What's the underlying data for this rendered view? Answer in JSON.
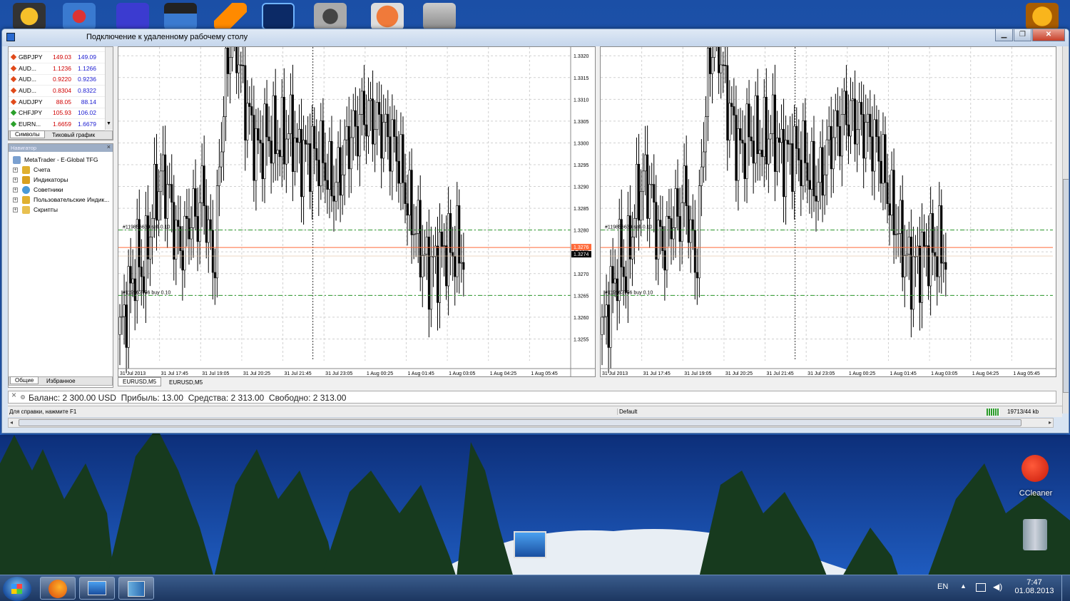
{
  "window": {
    "title": "Подключение к удаленному рабочему столу",
    "buttons": [
      "minimize",
      "maximize",
      "close"
    ]
  },
  "market_watch": {
    "rows": [
      {
        "symbol": "GBPJPY",
        "bid": "149.03",
        "ask": "149.09",
        "trend": "down"
      },
      {
        "symbol": "AUD...",
        "bid": "1.1236",
        "ask": "1.1266",
        "trend": "down"
      },
      {
        "symbol": "AUD...",
        "bid": "0.9220",
        "ask": "0.9236",
        "trend": "down"
      },
      {
        "symbol": "AUD...",
        "bid": "0.8304",
        "ask": "0.8322",
        "trend": "down"
      },
      {
        "symbol": "AUDJPY",
        "bid": "88.05",
        "ask": "88.14",
        "trend": "down"
      },
      {
        "symbol": "CHFJPY",
        "bid": "105.93",
        "ask": "106.02",
        "trend": "up"
      },
      {
        "symbol": "EURN...",
        "bid": "1.6659",
        "ask": "1.6679",
        "trend": "up"
      }
    ],
    "tabs": [
      "Символы",
      "Тиковый график"
    ]
  },
  "navigator": {
    "title": "Навигатор",
    "items": [
      {
        "label": "MetaTrader - E-Global TFG",
        "icon": "terminal-icon"
      },
      {
        "label": "Счета",
        "icon": "accounts-icon"
      },
      {
        "label": "Индикаторы",
        "icon": "indicators-icon"
      },
      {
        "label": "Советники",
        "icon": "experts-icon"
      },
      {
        "label": "Пользовательские Индик...",
        "icon": "custom-indicators-icon"
      },
      {
        "label": "Скрипты",
        "icon": "scripts-icon"
      }
    ],
    "tabs": [
      "Общие",
      "Избранное"
    ]
  },
  "chart_data": [
    {
      "type": "candlestick",
      "symbol": "EURUSD,M5",
      "ylim": [
        1.325,
        1.3322
      ],
      "y_ticks": [
        "1.3320",
        "1.3315",
        "1.3310",
        "1.3305",
        "1.3300",
        "1.3295",
        "1.3290",
        "1.3285",
        "1.3280",
        "1.3275",
        "1.3270",
        "1.3265",
        "1.3260",
        "1.3255"
      ],
      "x_ticks": [
        "31 Jul 2013",
        "31 Jul 17:45",
        "31 Jul 19:05",
        "31 Jul 20:25",
        "31 Jul 21:45",
        "31 Jul 23:05",
        "1 Aug 00:25",
        "1 Aug 01:45",
        "1 Aug 03:05",
        "1 Aug 04:25",
        "1 Aug 05:45"
      ],
      "orders": [
        {
          "label": "#119856639 sell 0.10",
          "price": 1.328
        },
        {
          "label": "#119962756 buy 0.10",
          "price": 1.3265
        }
      ],
      "bid_line": 1.3276,
      "price_labels": [
        "1.3276",
        "1.3274"
      ],
      "path": [
        1.3256,
        1.3262,
        1.3268,
        1.3274,
        1.327,
        1.328,
        1.3288,
        1.3292,
        1.329,
        1.3282,
        1.3276,
        1.3278,
        1.3284,
        1.3282,
        1.329,
        1.3278,
        1.3272,
        1.33,
        1.3316,
        1.3328,
        1.332,
        1.331,
        1.3305,
        1.3298,
        1.33,
        1.3302,
        1.3301,
        1.33,
        1.3302,
        1.3303,
        1.3298,
        1.3297,
        1.3298,
        1.3297,
        1.3297,
        1.3293,
        1.329,
        1.3292,
        1.3298,
        1.3302,
        1.3303,
        1.3307,
        1.3306,
        1.3305,
        1.3304,
        1.3302,
        1.33,
        1.3297,
        1.329,
        1.3284,
        1.328,
        1.3275,
        1.3271,
        1.3272,
        1.3274,
        1.3276,
        1.3275,
        1.3276,
        1.3274
      ]
    },
    {
      "type": "candlestick",
      "symbol": "EURUSD,M5",
      "ylim": [
        1.325,
        1.3322
      ],
      "x_ticks": [
        "31 Jul 2013",
        "31 Jul 17:45",
        "31 Jul 19:05",
        "31 Jul 20:25",
        "31 Jul 21:45",
        "31 Jul 23:05",
        "1 Aug 00:25",
        "1 Aug 01:45",
        "1 Aug 03:05",
        "1 Aug 04:25",
        "1 Aug 05:45"
      ],
      "orders": [
        {
          "label": "#119856639 sell 0.10",
          "price": 1.328
        },
        {
          "label": "#119962756 buy 0.10",
          "price": 1.3265
        }
      ],
      "bid_line": 1.3276
    }
  ],
  "chart_tabs": [
    "EURUSD,M5",
    "EURUSD,M5"
  ],
  "terminal": {
    "summary": "Баланс: 2 300.00 USD  Прибыль: 13.00  Средства: 2 313.00  Свободно: 2 313.00"
  },
  "statusbar": {
    "help": "Для справки, нажмите F1",
    "profile": "Default",
    "traffic": "19713/44 kb"
  },
  "desktop": {
    "icons": [
      {
        "label": "CCleaner"
      }
    ]
  },
  "taskbar": {
    "language": "EN",
    "time": "7:47",
    "date": "01.08.2013"
  },
  "colors": {
    "desktop_sky": "#1a4fa8",
    "bid_red": "#d00000",
    "ask_blue": "#1a1ad0",
    "order_line": "#2a9a2a",
    "bid_line": "#ff6a3a"
  }
}
